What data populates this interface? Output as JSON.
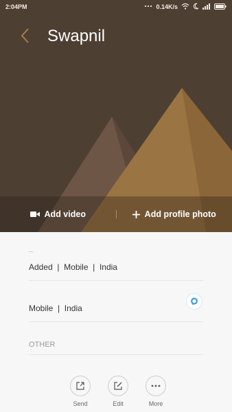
{
  "status_bar": {
    "time": "2:04PM",
    "net_speed": "0.14K/s",
    "icons": [
      "dots-icon",
      "wifi-icon",
      "moon-icon",
      "signal-icon",
      "battery-icon"
    ]
  },
  "header": {
    "contact_name": "Swapnil",
    "back_icon": "back-arrow-icon",
    "colors": {
      "background": "#4e3f33",
      "accent": "#a67f46"
    }
  },
  "actions": {
    "add_video": {
      "label": "Add video",
      "icon": "video-camera-icon"
    },
    "add_photo": {
      "label": "Add profile photo",
      "icon": "plus-icon"
    }
  },
  "details": {
    "row1": "Added  |  Mobile  |  India",
    "row2": "Mobile  |  India",
    "section_other": "OTHER"
  },
  "bottom_actions": [
    {
      "label": "Send",
      "icon": "share-icon"
    },
    {
      "label": "Edit",
      "icon": "edit-icon"
    },
    {
      "label": "More",
      "icon": "more-icon"
    }
  ]
}
